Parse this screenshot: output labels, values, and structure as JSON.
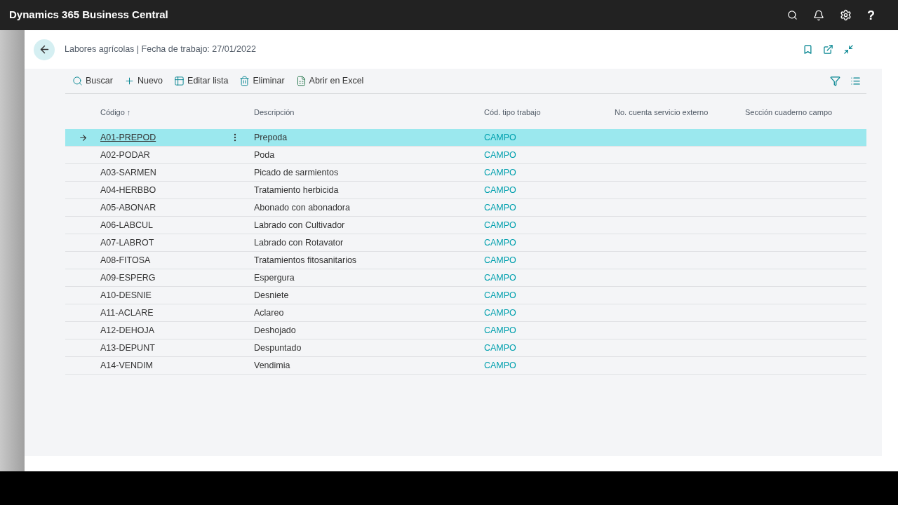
{
  "app": {
    "title": "Dynamics 365 Business Central",
    "help": "?"
  },
  "page": {
    "title": "Labores agrícolas | Fecha de trabajo: 27/01/2022"
  },
  "actions": [
    {
      "kind": "search",
      "label": "Buscar"
    },
    {
      "kind": "new",
      "label": "Nuevo"
    },
    {
      "kind": "edit",
      "label": "Editar lista"
    },
    {
      "kind": "delete",
      "label": "Eliminar"
    },
    {
      "kind": "excel",
      "label": "Abrir en Excel"
    }
  ],
  "table": {
    "columns": [
      "Código",
      "Descripción",
      "Cód. tipo trabajo",
      "No. cuenta servicio externo",
      "Sección cuaderno campo"
    ],
    "sort_arrow": "↑",
    "rows": [
      {
        "code": "A01-PREPOD",
        "description": "Prepoda",
        "type": "CAMPO",
        "selected": true
      },
      {
        "code": "A02-PODAR",
        "description": "Poda",
        "type": "CAMPO",
        "selected": false
      },
      {
        "code": "A03-SARMEN",
        "description": "Picado de sarmientos",
        "type": "CAMPO",
        "selected": false
      },
      {
        "code": "A04-HERBBO",
        "description": "Tratamiento herbicida",
        "type": "CAMPO",
        "selected": false
      },
      {
        "code": "A05-ABONAR",
        "description": "Abonado con abonadora",
        "type": "CAMPO",
        "selected": false
      },
      {
        "code": "A06-LABCUL",
        "description": "Labrado con Cultivador",
        "type": "CAMPO",
        "selected": false
      },
      {
        "code": "A07-LABROT",
        "description": "Labrado con Rotavator",
        "type": "CAMPO",
        "selected": false
      },
      {
        "code": "A08-FITOSA",
        "description": "Tratamientos fitosanitarios",
        "type": "CAMPO",
        "selected": false
      },
      {
        "code": "A09-ESPERG",
        "description": "Espergura",
        "type": "CAMPO",
        "selected": false
      },
      {
        "code": "A10-DESNIE",
        "description": "Desniete",
        "type": "CAMPO",
        "selected": false
      },
      {
        "code": "A11-ACLARE",
        "description": "Aclareo",
        "type": "CAMPO",
        "selected": false
      },
      {
        "code": "A12-DEHOJA",
        "description": "Deshojado",
        "type": "CAMPO",
        "selected": false
      },
      {
        "code": "A13-DEPUNT",
        "description": "Despuntado",
        "type": "CAMPO",
        "selected": false
      },
      {
        "code": "A14-VENDIM",
        "description": "Vendimia",
        "type": "CAMPO",
        "selected": false
      }
    ]
  }
}
